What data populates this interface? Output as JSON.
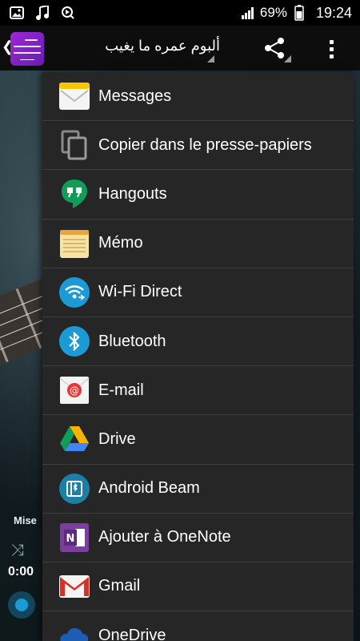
{
  "status_bar": {
    "battery_percent": "69%",
    "time": "19:24",
    "left_icons": [
      "picture-icon",
      "music-note-icon",
      "media-icon"
    ],
    "right_icons": [
      "signal-icon",
      "battery-icon"
    ]
  },
  "app_bar": {
    "title": "ألبوم عمره ما يغيب",
    "back_glyph": "❮",
    "share_icon": "share-icon",
    "overflow_icon": "more-vert-icon"
  },
  "background": {
    "mode_label": "Mise",
    "elapsed_time": "0:00"
  },
  "share_menu": {
    "items": [
      {
        "label": "Messages",
        "icon": "envelope-icon"
      },
      {
        "label": "Copier dans le presse-papiers",
        "icon": "copy-icon"
      },
      {
        "label": "Hangouts",
        "icon": "hangouts-icon"
      },
      {
        "label": "Mémo",
        "icon": "memo-icon"
      },
      {
        "label": "Wi-Fi Direct",
        "icon": "wifi-direct-icon"
      },
      {
        "label": "Bluetooth",
        "icon": "bluetooth-icon"
      },
      {
        "label": "E-mail",
        "icon": "email-icon"
      },
      {
        "label": "Drive",
        "icon": "drive-icon"
      },
      {
        "label": "Android Beam",
        "icon": "android-beam-icon"
      },
      {
        "label": "Ajouter à OneNote",
        "icon": "onenote-icon"
      },
      {
        "label": "Gmail",
        "icon": "gmail-icon"
      },
      {
        "label": "OneDrive",
        "icon": "onedrive-icon"
      }
    ]
  },
  "colors": {
    "popup_bg": "#262626",
    "divider": "#3e3e3e",
    "accent_blue": "#1b9bd6",
    "onenote_purple": "#7a3e9d",
    "app_icon_purple": "#9c27d8"
  }
}
